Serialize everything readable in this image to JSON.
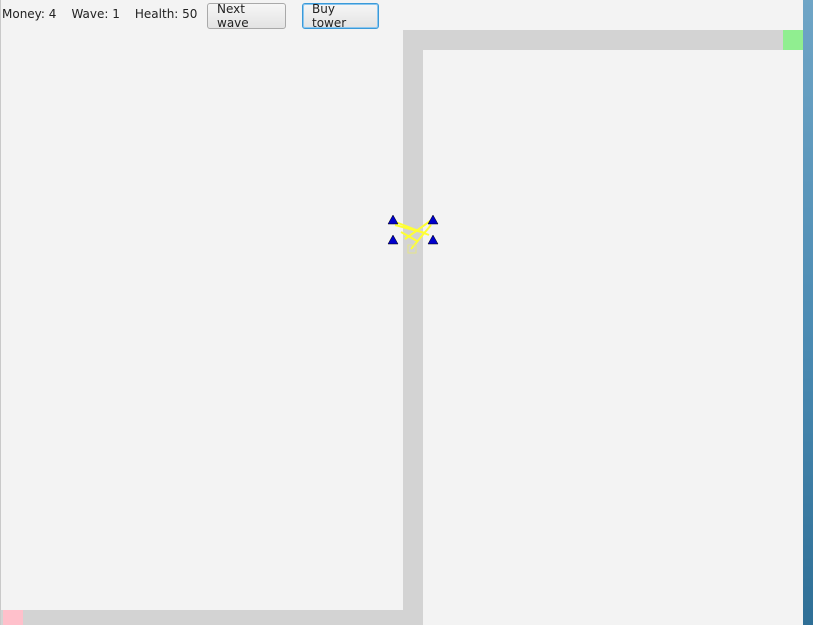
{
  "hud": {
    "money_label": "Money:",
    "money": "4",
    "wave_label": "Wave:",
    "wave": "1",
    "health_label": "Health:",
    "health": "50"
  },
  "buttons": {
    "next_wave": "Next wave",
    "buy_tower": "Buy tower"
  },
  "colors": {
    "path": "#d3d3d3",
    "goal": "#90ee90",
    "spawn": "#ffc0cb",
    "tower": "#0000cc",
    "laser": "#ffff33",
    "background": "#f3f3f3"
  }
}
